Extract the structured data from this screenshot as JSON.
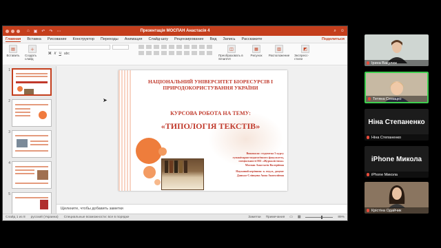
{
  "window": {
    "title": "Презентація МОСПАН Анастасія 4"
  },
  "menu": {
    "tabs": [
      "Главная",
      "Вставка",
      "Рисование",
      "Конструктор",
      "Переходы",
      "Анимация",
      "Слайд-шоу",
      "Рецензирование",
      "Вид",
      "Запись",
      "Расскажите"
    ],
    "share_label": "Поделиться"
  },
  "ribbon": {
    "paste_label": "Вставить",
    "new_slide_label": "Создать слайд",
    "convert_label": "Преобразовать в SmartArt",
    "picture_label": "Рисунок",
    "arrange_label": "Расположение",
    "express_styles_label": "Экспресс-стили"
  },
  "slide": {
    "university": "НАЦІОНАЛЬНИЙ УНІВЕРСИТЕТ БІОРЕСУРСІВ І ПРИРОДОКОРИСТУВАННЯ УКРАЇНИ",
    "course_heading": "КУРСОВА РОБОТА НА ТЕМУ:",
    "topic": "«ТИПОЛОГІЯ ТЕКСТІВ»",
    "author_lines": [
      "Виконала: студентка 3 курсу",
      "гуманітарно-педагогічного факультету,",
      "спеціальності 061 «Журналістика»",
      "Моспан Анастасія Валеріївна"
    ],
    "advisor_lines": [
      "Науковий керівник: к. пед.н., доцент",
      "Данько-Сліпцова Анна Анатоліївна"
    ]
  },
  "thumbnails": [
    {
      "num": "1",
      "selected": true
    },
    {
      "num": "2",
      "selected": false
    },
    {
      "num": "3",
      "selected": false
    },
    {
      "num": "4",
      "selected": false
    },
    {
      "num": "5",
      "selected": false
    }
  ],
  "notes": {
    "placeholder": "Щелкните, чтобы добавить заметки"
  },
  "status": {
    "slide_counter": "Слайд 1 из 8",
    "language": "русский (Украина)",
    "accessibility": "Специальные возможности: все в порядке",
    "notes_btn": "Заметки",
    "comments_btn": "Примечания",
    "zoom": "89%"
  },
  "participants": [
    {
      "name": "Ірина Вакулюк",
      "type": "video"
    },
    {
      "name": "Тетяна Семацко",
      "type": "video",
      "active": true
    },
    {
      "name": "Ніна Степаненко",
      "label": "Ніна Степаненко",
      "type": "name"
    },
    {
      "name": "iPhone Микола",
      "label": "iPhone Микола",
      "type": "name"
    },
    {
      "name": "Крістіна Одайчик",
      "type": "video"
    }
  ]
}
